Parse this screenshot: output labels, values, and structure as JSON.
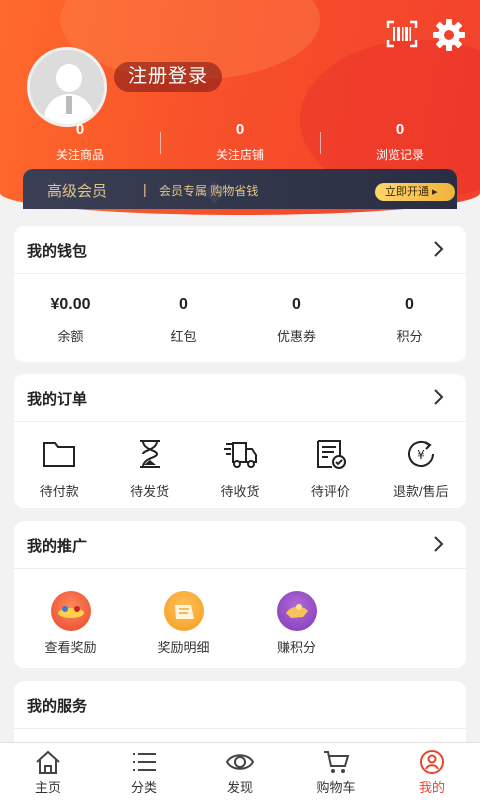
{
  "header": {
    "login_label": "注册登录",
    "stats": [
      {
        "value": "0",
        "label": "关注商品"
      },
      {
        "value": "0",
        "label": "关注店铺"
      },
      {
        "value": "0",
        "label": "浏览记录"
      }
    ],
    "vip": {
      "title": "高级会员",
      "separator": "|",
      "subtitle": "会员专属 购物省钱",
      "button_label": "立即开通 ▸"
    }
  },
  "wallet": {
    "title": "我的钱包",
    "items": [
      {
        "value": "¥0.00",
        "label": "余额"
      },
      {
        "value": "0",
        "label": "红包"
      },
      {
        "value": "0",
        "label": "优惠券"
      },
      {
        "value": "0",
        "label": "积分"
      }
    ]
  },
  "orders": {
    "title": "我的订单",
    "items": [
      {
        "label": "待付款",
        "icon": "folder-icon"
      },
      {
        "label": "待发货",
        "icon": "hourglass-icon"
      },
      {
        "label": "待收货",
        "icon": "truck-icon"
      },
      {
        "label": "待评价",
        "icon": "review-icon"
      },
      {
        "label": "退款/售后",
        "icon": "refund-icon"
      }
    ]
  },
  "promotion": {
    "title": "我的推广",
    "items": [
      {
        "label": "查看奖励",
        "icon": "reward-icon"
      },
      {
        "label": "奖励明细",
        "icon": "reward-detail-icon"
      },
      {
        "label": "赚积分",
        "icon": "earn-points-icon"
      }
    ]
  },
  "services": {
    "title": "我的服务"
  },
  "tabbar": {
    "items": [
      {
        "label": "主页",
        "icon": "home-icon"
      },
      {
        "label": "分类",
        "icon": "category-icon"
      },
      {
        "label": "发现",
        "icon": "eye-icon"
      },
      {
        "label": "购物车",
        "icon": "cart-icon"
      },
      {
        "label": "我的",
        "icon": "user-icon"
      }
    ],
    "active_index": 4
  },
  "colors": {
    "primary": "#f2412c",
    "header_gradient_start": "#ff6a2b",
    "vip_bg": "#2a2e42",
    "vip_gold": "#e4c486",
    "active_tab": "#e8452f"
  }
}
